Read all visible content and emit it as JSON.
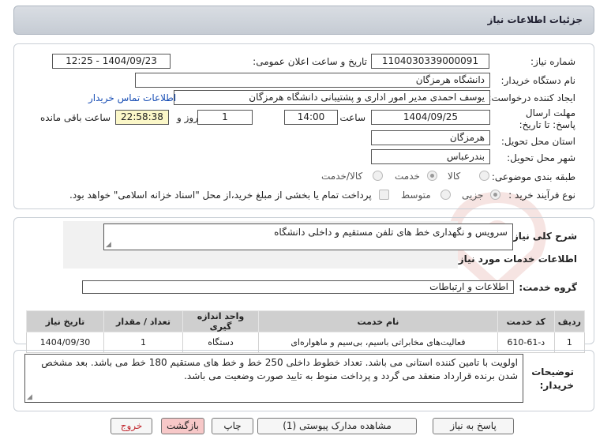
{
  "header": {
    "title": "جزئیات اطلاعات نیاز"
  },
  "fields": {
    "need_number_label": "شماره نیاز:",
    "need_number": "1104030339000091",
    "announce_label": "تاریخ و ساعت اعلان عمومی:",
    "announce_value": "1404/09/23 - 12:25",
    "buyer_label": "نام دستگاه خریدار:",
    "buyer": "دانشگاه هرمزگان",
    "creator_label": "ایجاد کننده درخواست:",
    "creator": "یوسف احمدی مدیر امور اداری و پشتیبانی دانشگاه هرمزگان",
    "contact_link": "اطلاعات تماس خریدار",
    "deadline_label": "مهلت ارسال پاسخ: تا تاریخ:",
    "deadline_date": "1404/09/25",
    "time_label": "ساعت",
    "deadline_time": "14:00",
    "days_value": "1",
    "days_label": "روز و",
    "remaining_value": "22:58:38",
    "remaining_label": "ساعت باقی مانده",
    "province_label": "استان محل تحویل:",
    "province": "هرمزگان",
    "city_label": "شهر محل تحویل:",
    "city": "بندرعباس",
    "category_label": "طبقه بندی موضوعی:",
    "category_options": [
      "کالا",
      "خدمت",
      "کالا/خدمت"
    ],
    "category_selected": "خدمت",
    "process_label": "نوع فرآیند خرید :",
    "process_options": [
      "جزیی",
      "متوسط"
    ],
    "process_selected": "جزیی",
    "payment_note": "پرداخت تمام یا بخشی از مبلغ خرید،از محل \"اسناد خزانه اسلامی\" خواهد بود."
  },
  "general": {
    "desc_label": "شرح کلی نیاز:",
    "desc_value": "سرویس و نگهداری خط های تلفن مستقیم و داخلی دانشگاه",
    "services_title": "اطلاعات خدمات مورد نیاز",
    "group_label": "گروه خدمت:",
    "group_value": "اطلاعات و ارتباطات"
  },
  "table": {
    "columns": [
      "ردیف",
      "کد خدمت",
      "نام خدمت",
      "واحد اندازه گیری",
      "تعداد / مقدار",
      "تاریخ نیاز"
    ],
    "rows": [
      [
        "1",
        "د-61-610",
        "فعالیت‌های مخابراتی باسیم، بی‌سیم و ماهواره‌ای",
        "دستگاه",
        "1",
        "1404/09/30"
      ]
    ]
  },
  "notes": {
    "label": "توضیحات خریدار:",
    "text": "اولویت با تامین کننده استانی می باشد. تعداد خطوط داخلی 250 خط و خط های مستقیم 180 خط می باشد. بعد مشخص شدن برنده قرارداد منعقد می گردد و پرداخت منوط به تایید صورت وضعیت می باشد."
  },
  "buttons": {
    "reply": "پاسخ به نیاز",
    "attachments": "مشاهده مدارک پیوستی (1)",
    "print": "چاپ",
    "back": "بازگشت",
    "exit": "خروج"
  }
}
